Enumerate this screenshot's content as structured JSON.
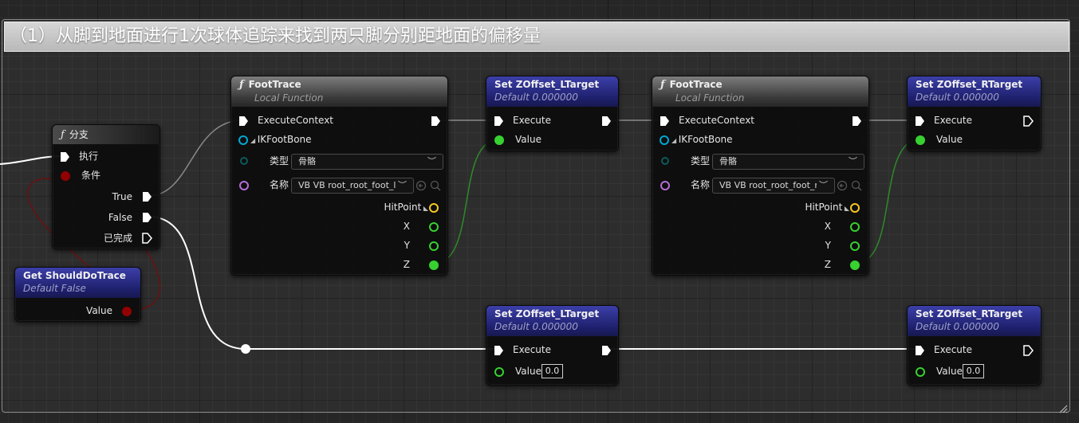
{
  "comment": {
    "title": "（1）从脚到地面进行1次球体追踪来找到两只脚分别距地面的偏移量"
  },
  "branch_node": {
    "title": "分支",
    "exec_in": "执行",
    "condition": "条件",
    "true_out": "True",
    "false_out": "False",
    "completed_out": "已完成"
  },
  "get_node": {
    "title": "Get ShouldDoTrace",
    "subtitle": "Default False",
    "value_label": "Value"
  },
  "foot_trace_nodes": [
    {
      "title": "FootTrace",
      "subtitle": "Local Function",
      "execute": "ExecuteContext",
      "ik_foot_bone": "IKFootBone",
      "type_label": "类型",
      "type_value": "骨骼",
      "name_label": "名称",
      "name_value": "VB VB root_root_foot_l",
      "hitpoint": "HitPoint",
      "x": "X",
      "y": "Y",
      "z": "Z"
    },
    {
      "title": "FootTrace",
      "subtitle": "Local Function",
      "execute": "ExecuteContext",
      "ik_foot_bone": "IKFootBone",
      "type_label": "类型",
      "type_value": "骨骼",
      "name_label": "名称",
      "name_value": "VB VB root_root_foot_r",
      "hitpoint": "HitPoint",
      "x": "X",
      "y": "Y",
      "z": "Z"
    }
  ],
  "set_nodes": [
    {
      "title": "Set ZOffset_LTarget",
      "subtitle": "Default 0.000000",
      "execute": "Execute",
      "value_label": "Value",
      "value": ""
    },
    {
      "title": "Set ZOffset_RTarget",
      "subtitle": "Default 0.000000",
      "execute": "Execute",
      "value_label": "Value",
      "value": ""
    },
    {
      "title": "Set ZOffset_LTarget",
      "subtitle": "Default 0.000000",
      "execute": "Execute",
      "value_label": "Value",
      "value": "0.0"
    },
    {
      "title": "Set ZOffset_RTarget",
      "subtitle": "Default 0.000000",
      "execute": "Execute",
      "value_label": "Value",
      "value": "0.0"
    }
  ],
  "colors": {
    "exec_wire": "#ffffff",
    "bool_pin": "#920101",
    "float_pin": "#37d130",
    "struct_pin": "#00a8d4",
    "name_pin": "#b46ed8",
    "vector_pin": "#f7c821",
    "function_header": "#5a5a5a",
    "variable_header": "#23268a"
  },
  "icons": [
    "function-icon",
    "exec-pin-icon",
    "data-pin-icon",
    "reset-arrow-icon",
    "search-icon",
    "chevron-down-icon",
    "resize-grip-icon",
    "reroute-knot"
  ]
}
